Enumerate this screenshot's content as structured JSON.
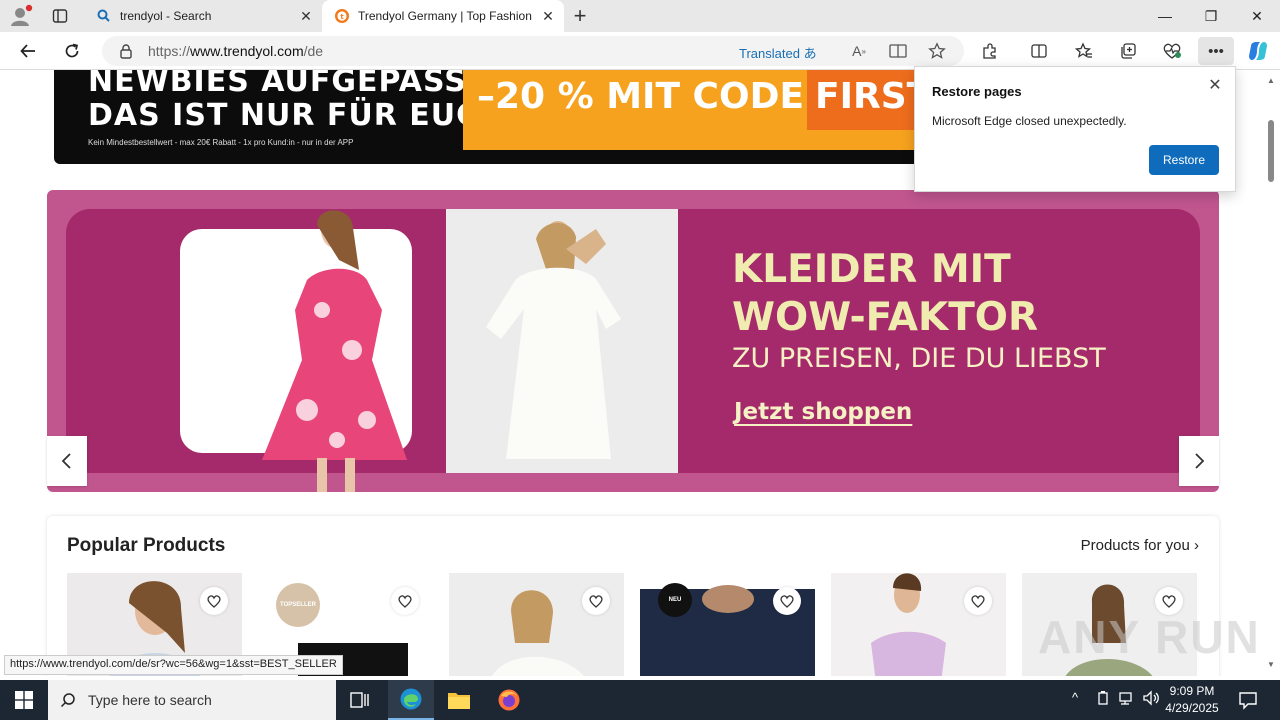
{
  "tabs": [
    {
      "label": "trendyol - Search"
    },
    {
      "label": "Trendyol Germany | Top Fashion"
    }
  ],
  "window_controls": {
    "minimize": "—",
    "restore": "❐",
    "close": "✕"
  },
  "address": {
    "url_prefix": "https://",
    "url_domain": "www.trendyol.com",
    "url_path": "/de",
    "translated_label": "Translated"
  },
  "banner_top": {
    "line1": "NEWBIES AUFGEPASST!",
    "line2": "DAS IST NUR FÜR EUCH",
    "fine_print": "Kein Mindestbestellwert - max 20€ Rabatt - 1x pro Kund:in - nur in der APP",
    "code_text": "–20 % MIT CODE:",
    "code_value": "FIRST"
  },
  "hero": {
    "title_line1": "KLEIDER MIT",
    "title_line2": "WOW-FAKTOR",
    "subtitle": "ZU PREISEN, DIE DU LIEBST",
    "cta": "Jetzt shoppen",
    "colors": {
      "outer": "#c1568f",
      "inner": "#a42a6b",
      "text": "#f0ecb0"
    }
  },
  "popular": {
    "title": "Popular Products",
    "link": "Products for you",
    "badges": {
      "topseller": "TOPSELLER",
      "neu": "NEU"
    }
  },
  "status_url": "https://www.trendyol.com/de/sr?wc=56&wg=1&sst=BEST_SELLER",
  "watermark": "ANY RUN",
  "restore_popup": {
    "title": "Restore pages",
    "message": "Microsoft Edge closed unexpectedly.",
    "button": "Restore"
  },
  "taskbar": {
    "search_placeholder": "Type here to search",
    "time": "9:09 PM",
    "date": "4/29/2025"
  }
}
